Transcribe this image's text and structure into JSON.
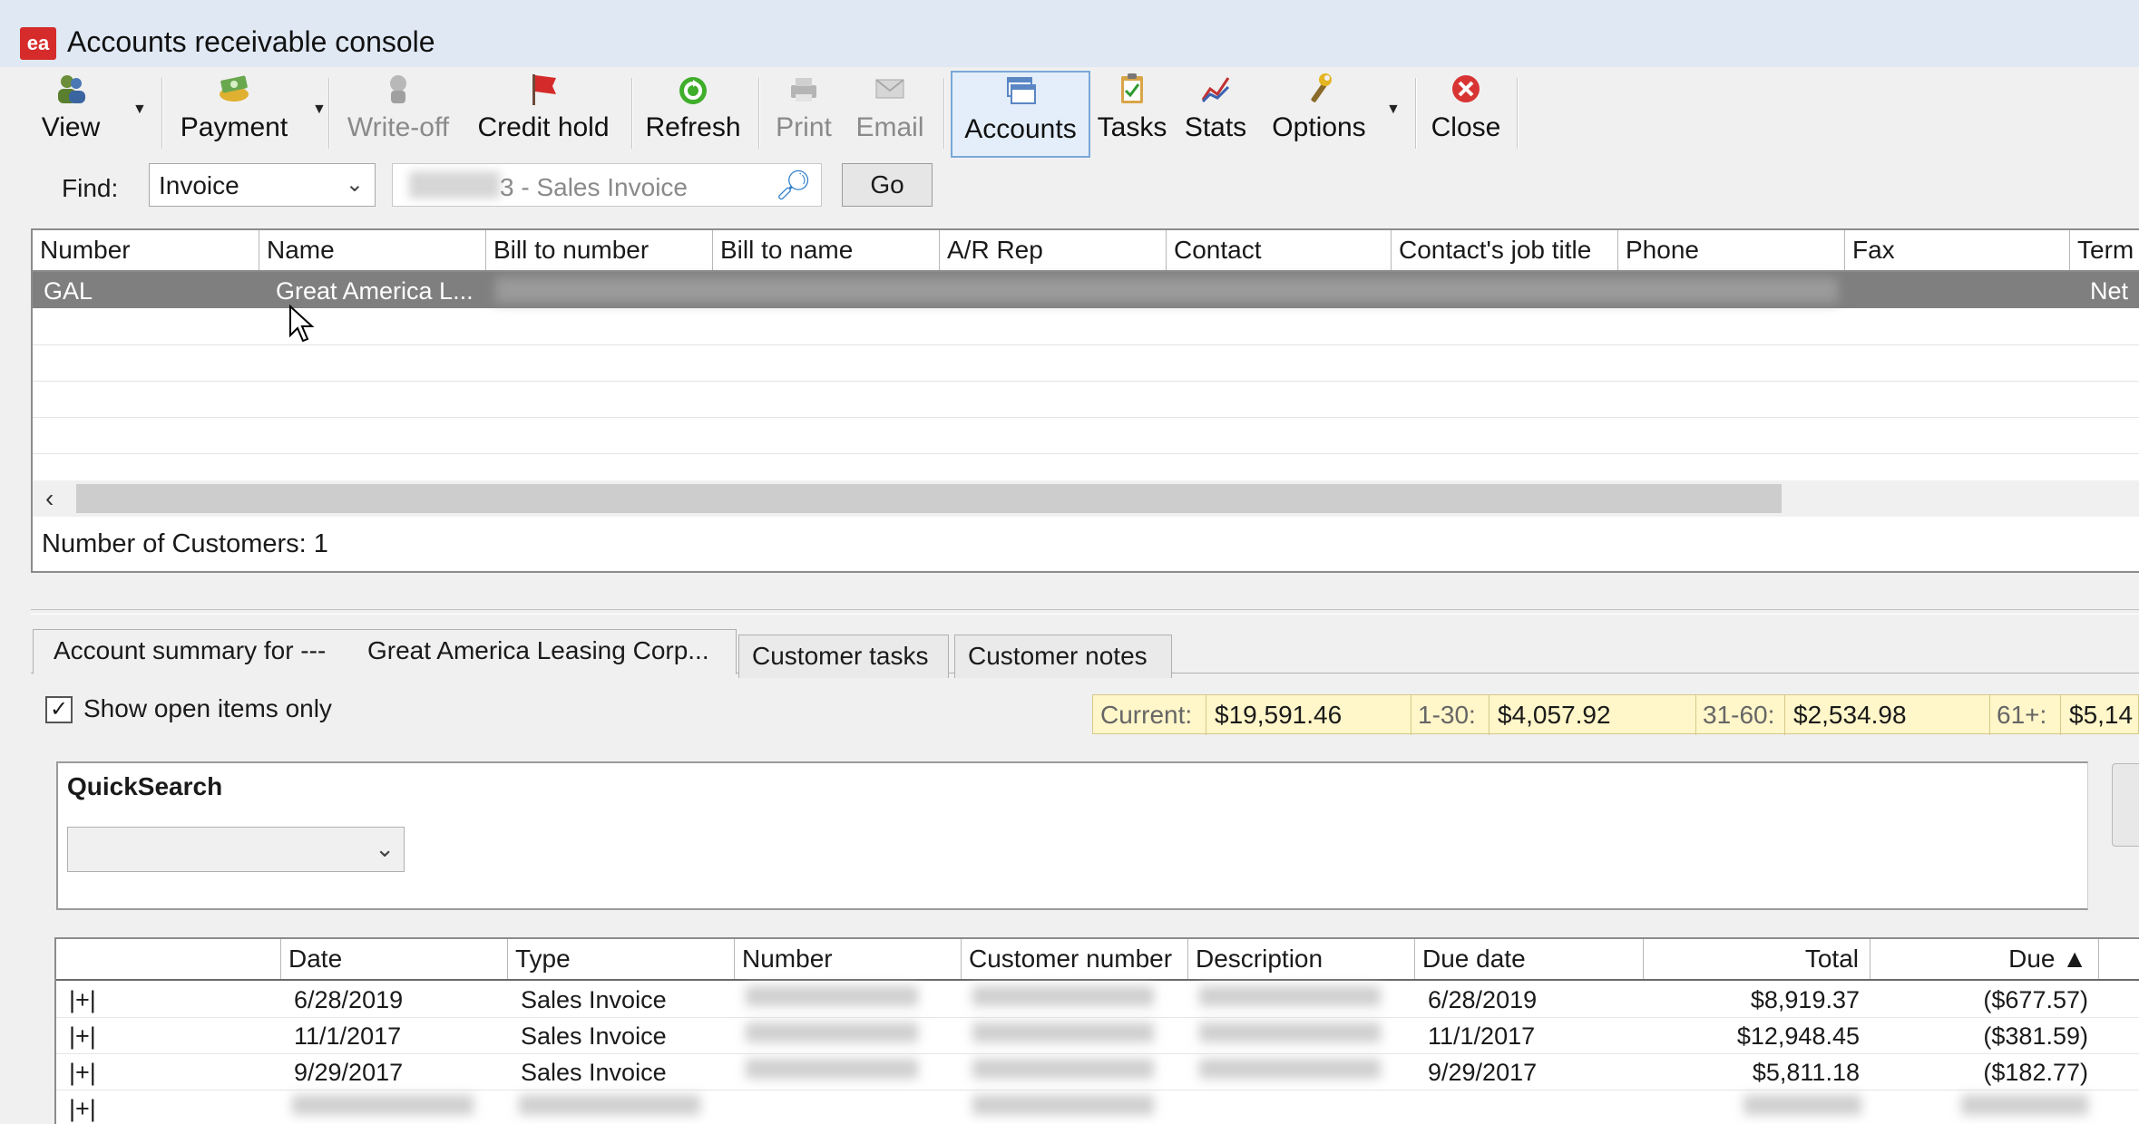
{
  "window": {
    "title": "Accounts receivable console",
    "app_icon_text": "ea"
  },
  "toolbar": {
    "view": "View",
    "payment": "Payment",
    "write_off": "Write-off",
    "credit_hold": "Credit hold",
    "refresh": "Refresh",
    "print": "Print",
    "email": "Email",
    "accounts": "Accounts",
    "tasks": "Tasks",
    "stats": "Stats",
    "options": "Options",
    "close": "Close"
  },
  "find": {
    "label": "Find:",
    "type_value": "Invoice",
    "search_value": "3 - Sales Invoice",
    "go_label": "Go"
  },
  "customers": {
    "columns": [
      "Number",
      "Name",
      "Bill to number",
      "Bill to name",
      "A/R Rep",
      "Contact",
      "Contact's job title",
      "Phone",
      "Fax",
      "Term"
    ],
    "rows": [
      {
        "number": "GAL",
        "name": "Great America L...",
        "terms": "Net"
      }
    ],
    "count_text": "Number of Customers: 1"
  },
  "tabs": {
    "summary_label": "Account summary for ---",
    "summary_name": "Great America Leasing Corp...",
    "customer_tasks": "Customer tasks",
    "customer_notes": "Customer notes"
  },
  "account": {
    "show_open_label": "Show open items only",
    "show_open_checked": "✓",
    "aging": {
      "current_label": "Current:",
      "current": "$19,591.46",
      "d1_30_label": "1-30:",
      "d1_30": "$4,057.92",
      "d31_60_label": "31-60:",
      "d31_60": "$2,534.98",
      "d61_label": "61+:",
      "d61": "$5,14"
    }
  },
  "quicksearch": {
    "title": "QuickSearch"
  },
  "invoices": {
    "columns": [
      "",
      "Date",
      "Type",
      "Number",
      "Customer number",
      "Description",
      "Due date",
      "Total",
      "Due ▲"
    ],
    "rows": [
      {
        "expander": "|+|",
        "date": "6/28/2019",
        "type": "Sales Invoice",
        "due_date": "6/28/2019",
        "total": "$8,919.37",
        "due": "($677.57)"
      },
      {
        "expander": "|+|",
        "date": "11/1/2017",
        "type": "Sales Invoice",
        "due_date": "11/1/2017",
        "total": "$12,948.45",
        "due": "($381.59)"
      },
      {
        "expander": "|+|",
        "date": "9/29/2017",
        "type": "Sales Invoice",
        "due_date": "9/29/2017",
        "total": "$5,811.18",
        "due": "($182.77)"
      },
      {
        "expander": "|+|",
        "date": "",
        "type": "",
        "due_date": "",
        "total": "",
        "due": ""
      }
    ]
  }
}
